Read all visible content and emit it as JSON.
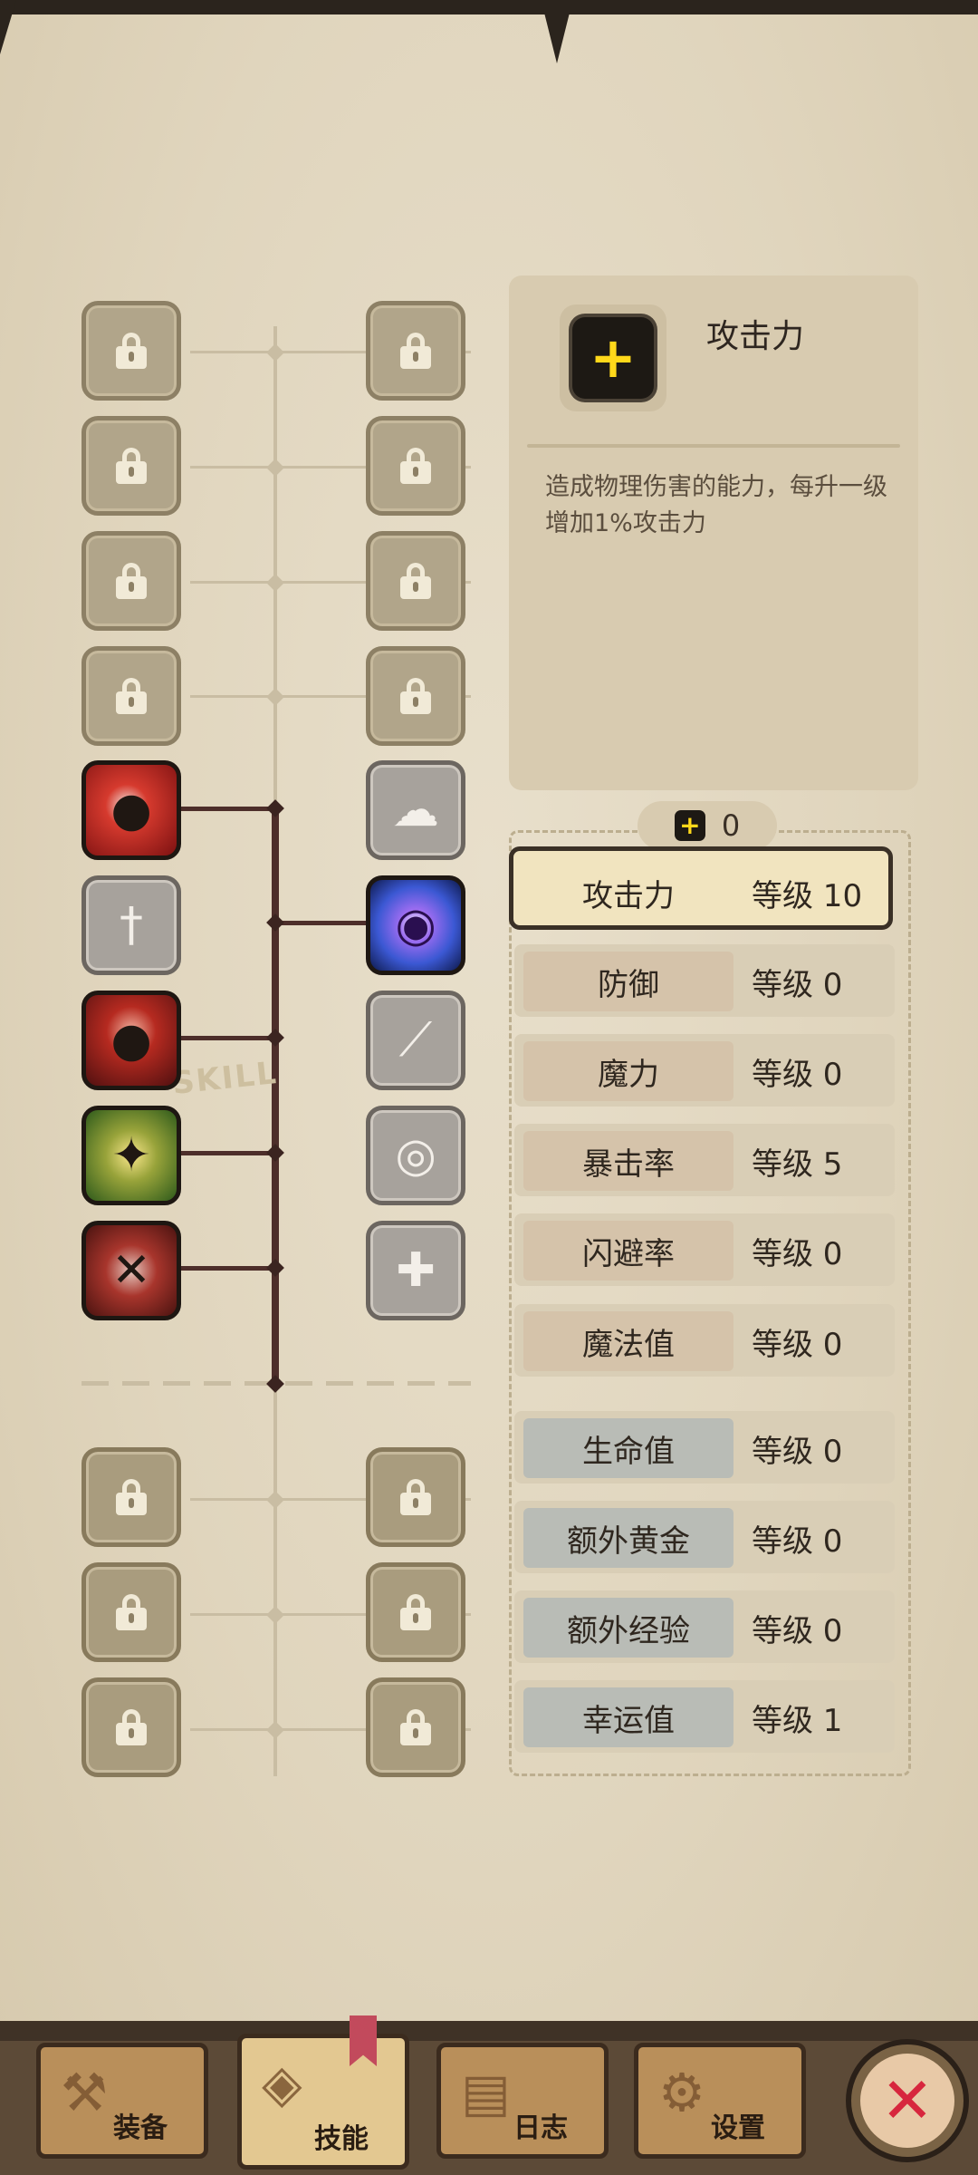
{
  "selected_skill": {
    "icon": "plus-icon",
    "title": "攻击力",
    "description": "造成物理伤害的能力，每升一级增加1%攻击力"
  },
  "skill_points": {
    "icon": "plus-icon",
    "value": "0"
  },
  "tree_label": "SKILL",
  "stats": [
    {
      "name": "攻击力",
      "level": "等级 10",
      "selected": true
    },
    {
      "name": "防御",
      "level": "等级 0"
    },
    {
      "name": "魔力",
      "level": "等级 0"
    },
    {
      "name": "暴击率",
      "level": "等级 5"
    },
    {
      "name": "闪避率",
      "level": "等级 0"
    },
    {
      "name": "魔法值",
      "level": "等级 0"
    },
    {
      "name": "生命值",
      "level": "等级 0"
    },
    {
      "name": "额外黄金",
      "level": "等级 0"
    },
    {
      "name": "额外经验",
      "level": "等级 0"
    },
    {
      "name": "幸运值",
      "level": "等级 1"
    }
  ],
  "tabs": [
    {
      "label": "装备",
      "icon": "axe-icon"
    },
    {
      "label": "技能",
      "icon": "skill-icon",
      "active": true
    },
    {
      "label": "日志",
      "icon": "scroll-icon"
    },
    {
      "label": "设置",
      "icon": "gear-icon"
    }
  ],
  "close": {
    "icon": "close-icon",
    "glyph": "✕"
  },
  "colors": {
    "accent": "#ffd81a",
    "close_red": "#d7263d",
    "line": "#4d2e2a"
  }
}
